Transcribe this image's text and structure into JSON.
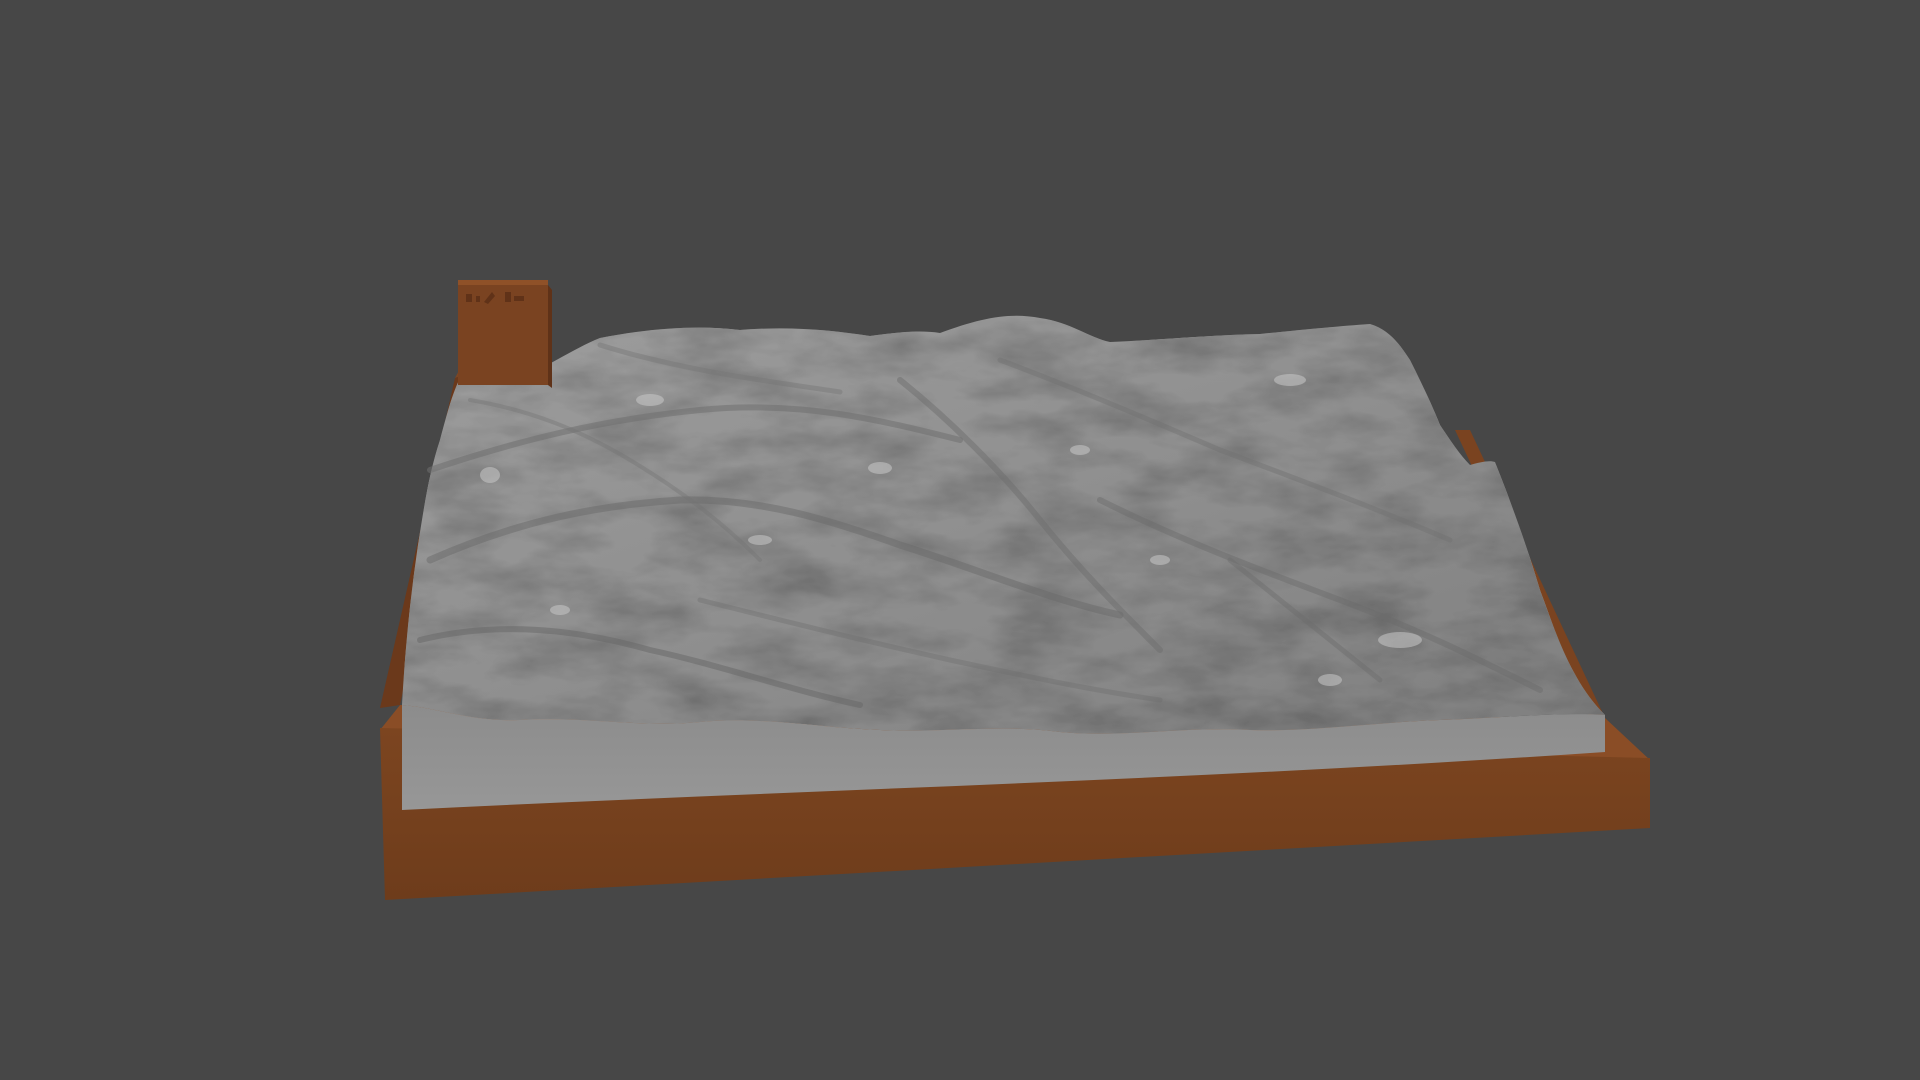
{
  "viewport": {
    "background_color": "#474747"
  },
  "model": {
    "name": "",
    "base_color": "#7a4420",
    "base_top_color": "#8a4e26",
    "base_side_color": "#6a3a1c",
    "terrain_color": "#8d8d8d",
    "terrain_highlight": "#b4b4b4",
    "terrain_shadow": "#5e5e5e",
    "terrain_front_face": "#9a9a9a",
    "label_block_icon": "label-block-icon"
  }
}
